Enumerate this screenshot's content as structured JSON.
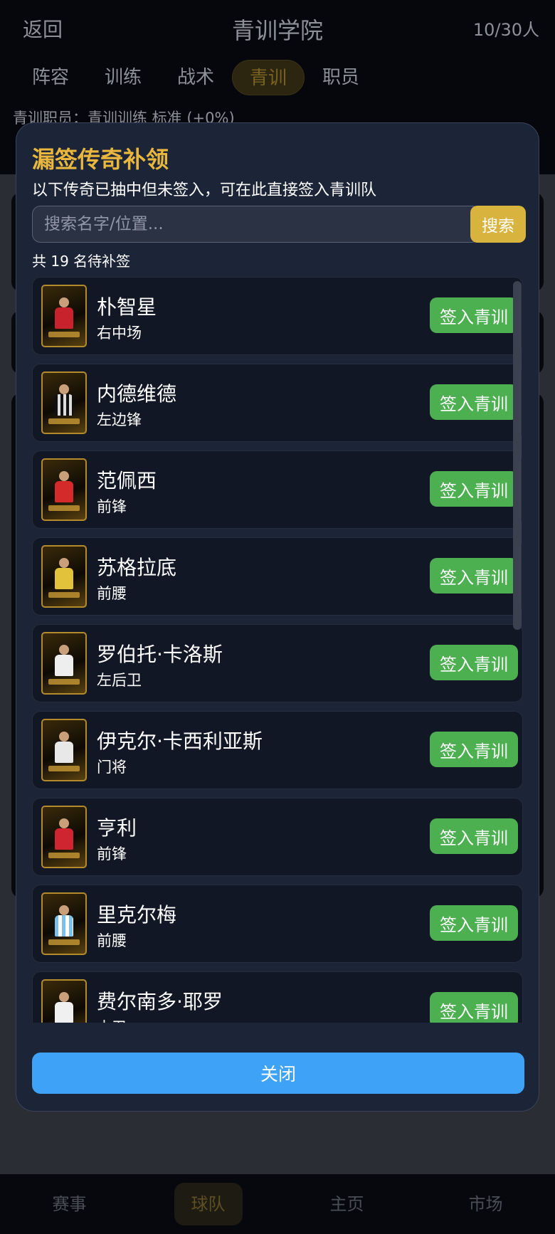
{
  "header": {
    "back_label": "返回",
    "title": "青训学院",
    "count": "10/30人"
  },
  "tabs": [
    {
      "label": "阵容",
      "active": false
    },
    {
      "label": "训练",
      "active": false
    },
    {
      "label": "战术",
      "active": false
    },
    {
      "label": "青训",
      "active": true
    },
    {
      "label": "职员",
      "active": false
    }
  ],
  "staff_line": "青训职员：青训训练 标准 (+0%)",
  "modal": {
    "title": "漏签传奇补领",
    "subtitle": "以下传奇已抽中但未签入，可在此直接签入青训队",
    "search_placeholder": "搜索名字/位置...",
    "search_label": "搜索",
    "count_text": "共 19 名待补签",
    "sign_label": "签入青训",
    "close_label": "关闭",
    "players": [
      {
        "name": "朴智星",
        "position": "右中场"
      },
      {
        "name": "内德维德",
        "position": "左边锋"
      },
      {
        "name": "范佩西",
        "position": "前锋"
      },
      {
        "name": "苏格拉底",
        "position": "前腰"
      },
      {
        "name": "罗伯托·卡洛斯",
        "position": "左后卫"
      },
      {
        "name": "伊克尔·卡西利亚斯",
        "position": "门将"
      },
      {
        "name": "亨利",
        "position": "前锋"
      },
      {
        "name": "里克尔梅",
        "position": "前腰"
      },
      {
        "name": "费尔南多·耶罗",
        "position": "中卫"
      }
    ]
  },
  "footer": {
    "items": [
      {
        "label": "赛事",
        "active": false
      },
      {
        "label": "球队",
        "active": true
      },
      {
        "label": "主页",
        "active": false
      },
      {
        "label": "市场",
        "active": false
      }
    ]
  },
  "colors": {
    "accent_gold": "#e9b73d",
    "sign_green": "#4caf50",
    "close_blue": "#3ea2f7",
    "modal_bg": "#1c2438"
  }
}
